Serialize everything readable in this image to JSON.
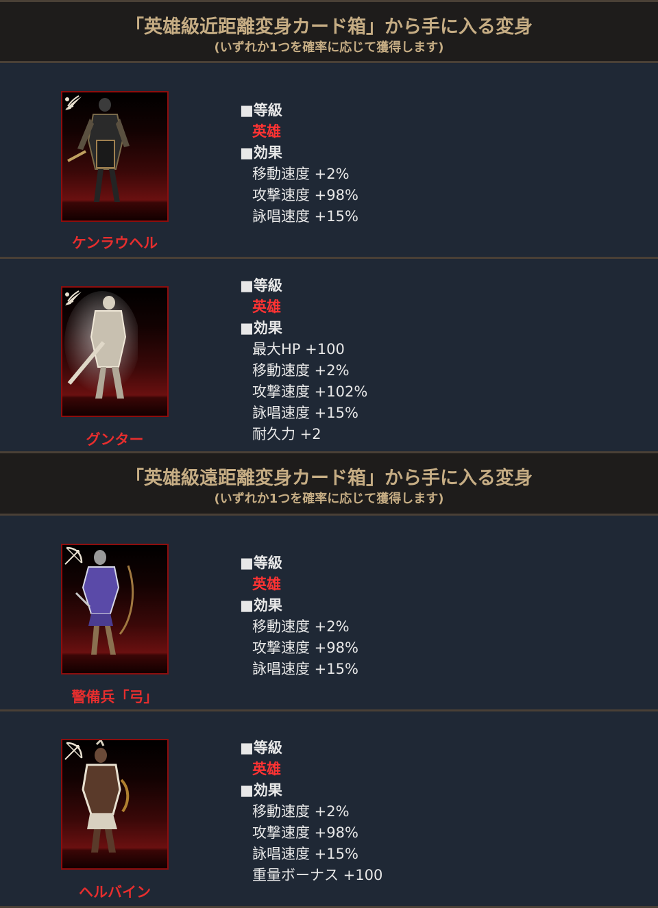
{
  "sections": [
    {
      "title": "「英雄級近距離変身カード箱」から手に入る変身",
      "subtitle": "(いずれか1つを確率に応じて獲得します)",
      "cards": [
        {
          "name": "ケンラウヘル",
          "icon": "melee-wing-icon",
          "grade_label": "■等級",
          "grade": "英雄",
          "effect_label": "■効果",
          "effects": [
            "移動速度 +2%",
            "攻撃速度 +98%",
            "詠唱速度 +15%"
          ]
        },
        {
          "name": "グンター",
          "icon": "melee-wing-icon",
          "grade_label": "■等級",
          "grade": "英雄",
          "effect_label": "■効果",
          "effects": [
            "最大HP +100",
            "移動速度 +2%",
            "攻撃速度 +102%",
            "詠唱速度 +15%",
            "耐久力 +2"
          ]
        }
      ]
    },
    {
      "title": "「英雄級遠距離変身カード箱」から手に入る変身",
      "subtitle": "(いずれか1つを確率に応じて獲得します)",
      "cards": [
        {
          "name": "警備兵「弓」",
          "icon": "bow-icon",
          "grade_label": "■等級",
          "grade": "英雄",
          "effect_label": "■効果",
          "effects": [
            "移動速度 +2%",
            "攻撃速度 +98%",
            "詠唱速度 +15%"
          ]
        },
        {
          "name": "ヘルバイン",
          "icon": "bow-icon",
          "grade_label": "■等級",
          "grade": "英雄",
          "effect_label": "■効果",
          "effects": [
            "移動速度 +2%",
            "攻撃速度 +98%",
            "詠唱速度 +15%",
            "重量ボーナス +100"
          ]
        }
      ]
    }
  ],
  "colors": {
    "background": "#1f2835",
    "header_background": "#1e1c1b",
    "header_text": "#c6ad84",
    "divider": "#4a4036",
    "name_red": "#e62e2e",
    "grade_red": "#ff3333",
    "portrait_border": "#8e0d0d",
    "text": "#e8e8e8"
  }
}
